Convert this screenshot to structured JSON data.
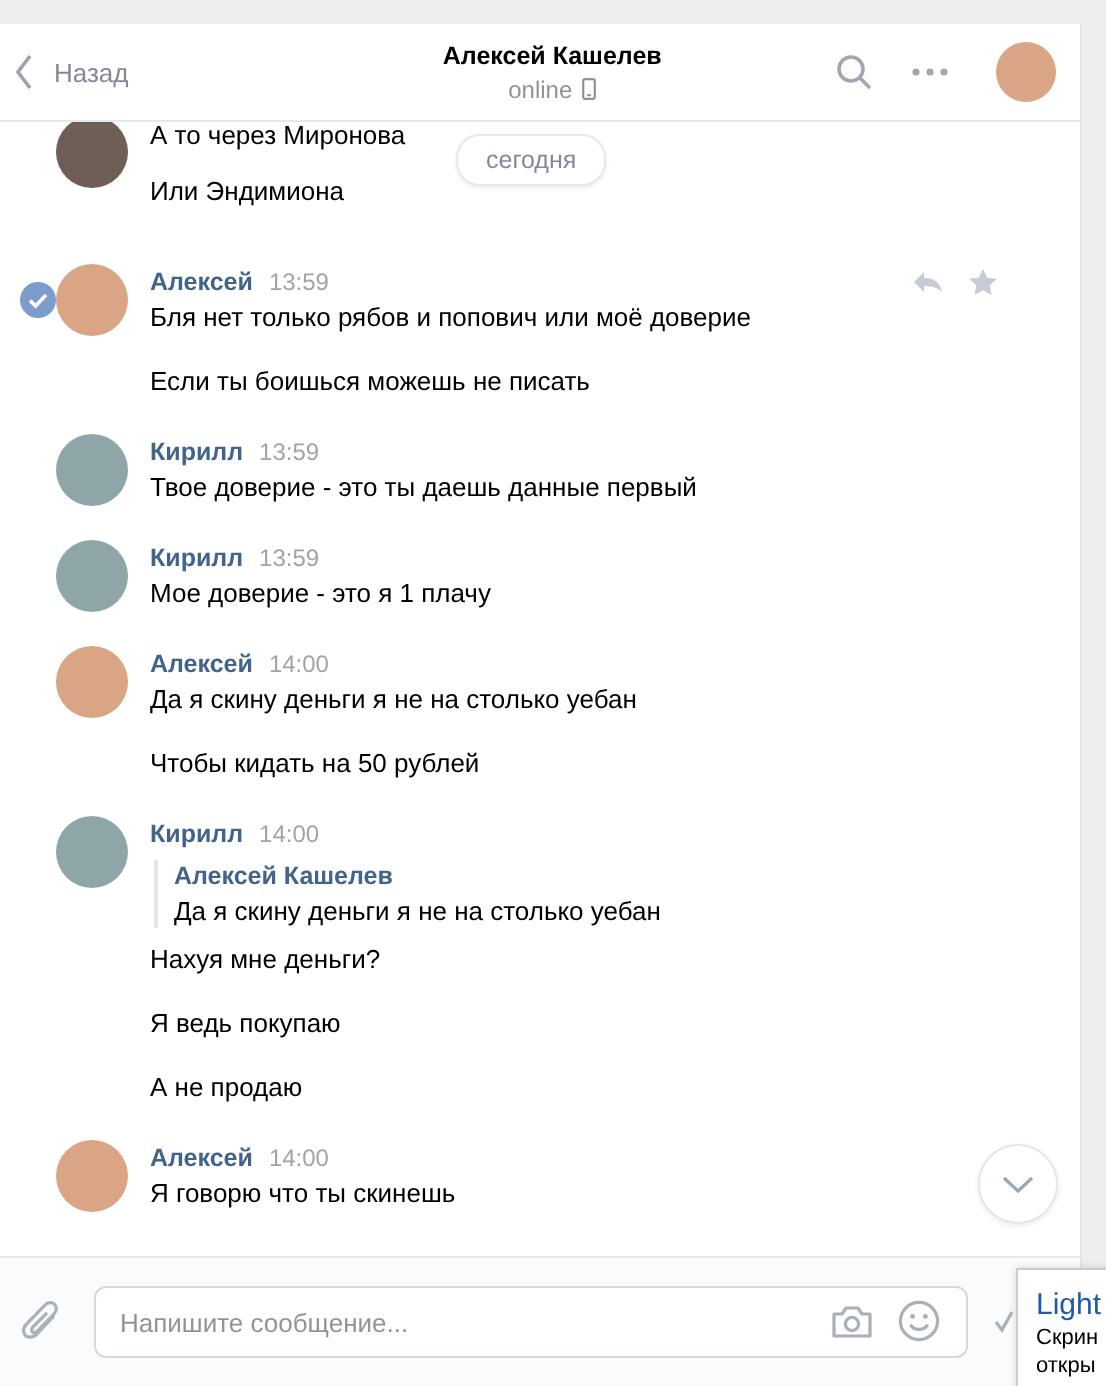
{
  "header": {
    "back": "Назад",
    "title": "Алексей Кашелев",
    "status": "online"
  },
  "date_pill": "сегодня",
  "messages": [
    {
      "color": "#6e5e55",
      "selected": false,
      "actions": false,
      "lines": [
        "А то через Миронова",
        "Или Эндимиона"
      ]
    },
    {
      "author": "Алексей",
      "time": "13:59",
      "color": "#d9a585",
      "selected": true,
      "actions": true,
      "lines": [
        "Бля нет только рябов и попович или моё доверие",
        "Если ты боишься можешь не писать"
      ]
    },
    {
      "author": "Кирилл",
      "time": "13:59",
      "color": "#8fa6a8",
      "selected": false,
      "actions": false,
      "lines": [
        "Твое доверие - это ты даешь данные первый"
      ]
    },
    {
      "author": "Кирилл",
      "time": "13:59",
      "color": "#8fa6a8",
      "selected": false,
      "actions": false,
      "lines": [
        "Мое доверие - это я 1 плачу"
      ]
    },
    {
      "author": "Алексей",
      "time": "14:00",
      "color": "#d9a585",
      "selected": false,
      "actions": false,
      "lines": [
        "Да я скину деньги я не на столько уебан",
        "Чтобы кидать на 50 рублей"
      ]
    },
    {
      "author": "Кирилл",
      "time": "14:00",
      "color": "#8fa6a8",
      "selected": false,
      "actions": false,
      "quote": {
        "author": "Алексей Кашелев",
        "text": "Да я скину деньги я не на столько уебан"
      },
      "lines": [
        "Нахуя мне деньги?",
        "Я ведь покупаю",
        "А не продаю"
      ]
    },
    {
      "author": "Алексей",
      "time": "14:00",
      "color": "#d9a585",
      "selected": false,
      "actions": false,
      "lines": [
        "Я говорю что ты скинешь"
      ]
    }
  ],
  "composer": {
    "placeholder": "Напишите сообщение..."
  },
  "notification": {
    "title": "Light",
    "lines": [
      "Скрин",
      "откры"
    ]
  }
}
